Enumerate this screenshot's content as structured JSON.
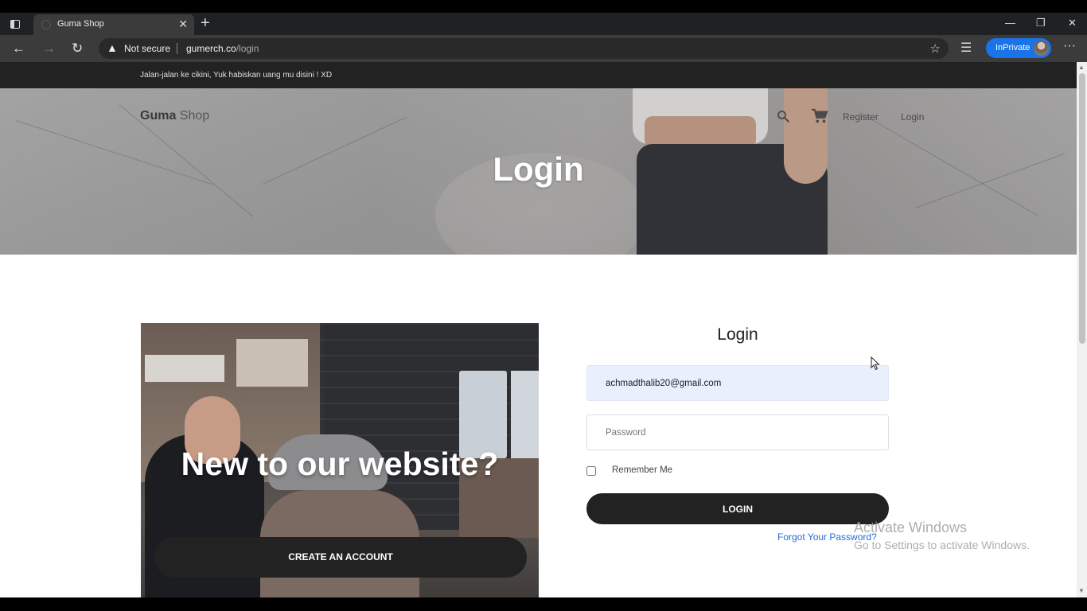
{
  "browser": {
    "tab_title": "Guma Shop",
    "not_secure_label": "Not secure",
    "url_domain": "gumerch.co",
    "url_path": "/login",
    "inprivate_label": "InPrivate"
  },
  "topbar": {
    "announcement": "Jalan-jalan ke cikini, Yuk habiskan uang mu disini ! XD"
  },
  "header": {
    "logo_bold": "Guma",
    "logo_light": " Shop",
    "nav": {
      "register": "Register",
      "login": "Login"
    },
    "page_title": "Login"
  },
  "promo": {
    "title": "New to our website?",
    "create_account_label": "CREATE AN ACCOUNT"
  },
  "login_form": {
    "title": "Login",
    "email_value": "achmadthalib20@gmail.com",
    "password_placeholder": "Password",
    "remember_label": "Remember Me",
    "remember_checked": false,
    "submit_label": "LOGIN",
    "forgot_label": "Forgot Your Password?"
  },
  "watermark": {
    "title": "Activate Windows",
    "subtitle": "Go to Settings to activate Windows."
  },
  "colors": {
    "accent_dark": "#222222",
    "link_blue": "#2a6bd6",
    "autofill_bg": "#e8f0fe",
    "inprivate_blue": "#1a73e8"
  }
}
